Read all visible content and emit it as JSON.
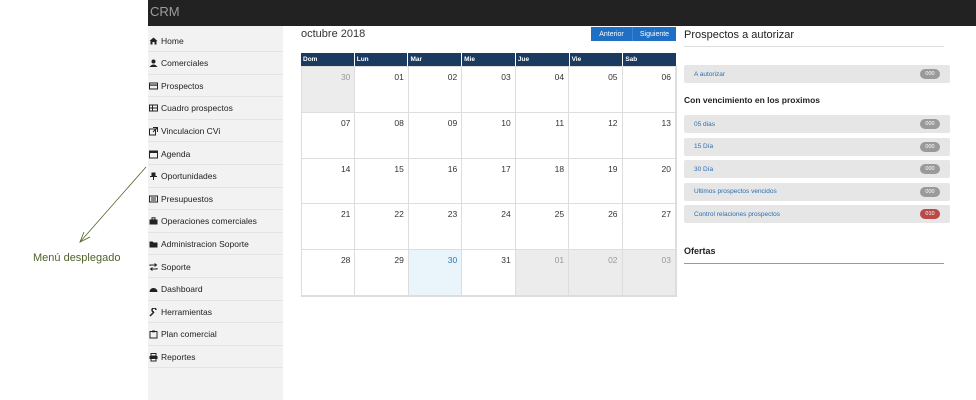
{
  "app": {
    "brand": "CRM"
  },
  "sidebar": {
    "items": [
      {
        "label": "Home",
        "icon": "home-icon"
      },
      {
        "label": "Comerciales",
        "icon": "user-icon"
      },
      {
        "label": "Prospectos",
        "icon": "credit-card-icon"
      },
      {
        "label": "Cuadro prospectos",
        "icon": "table-icon"
      },
      {
        "label": "Vinculacion CVi",
        "icon": "external-link-icon"
      },
      {
        "label": "Agenda",
        "icon": "calendar-icon"
      },
      {
        "label": "Oportunidades",
        "icon": "pin-icon"
      },
      {
        "label": "Presupuestos",
        "icon": "list-icon"
      },
      {
        "label": "Operaciones comerciales",
        "icon": "briefcase-icon"
      },
      {
        "label": "Administracion Soporte",
        "icon": "folder-open-icon"
      },
      {
        "label": "Soporte",
        "icon": "retweet-icon"
      },
      {
        "label": "Dashboard",
        "icon": "dashboard-icon"
      },
      {
        "label": "Herramientas",
        "icon": "wrench-icon"
      },
      {
        "label": "Plan comercial",
        "icon": "clipboard-icon"
      },
      {
        "label": "Reportes",
        "icon": "print-icon"
      }
    ]
  },
  "annotation": {
    "label": "Menú desplegado"
  },
  "calendar": {
    "month_label": "octubre 2018",
    "prev_label": "Anterior",
    "next_label": "Siguiente",
    "weekdays": [
      "Dom",
      "Lun",
      "Mar",
      "Mie",
      "Jue",
      "Vie",
      "Sab"
    ],
    "weeks": [
      [
        {
          "d": "30",
          "s": "other"
        },
        {
          "d": "01"
        },
        {
          "d": "02"
        },
        {
          "d": "03"
        },
        {
          "d": "04"
        },
        {
          "d": "05"
        },
        {
          "d": "06"
        }
      ],
      [
        {
          "d": "07"
        },
        {
          "d": "08"
        },
        {
          "d": "09"
        },
        {
          "d": "10"
        },
        {
          "d": "11"
        },
        {
          "d": "12"
        },
        {
          "d": "13"
        }
      ],
      [
        {
          "d": "14"
        },
        {
          "d": "15"
        },
        {
          "d": "16"
        },
        {
          "d": "17"
        },
        {
          "d": "18"
        },
        {
          "d": "19"
        },
        {
          "d": "20"
        }
      ],
      [
        {
          "d": "21"
        },
        {
          "d": "22"
        },
        {
          "d": "23"
        },
        {
          "d": "24"
        },
        {
          "d": "25"
        },
        {
          "d": "26"
        },
        {
          "d": "27"
        }
      ],
      [
        {
          "d": "28"
        },
        {
          "d": "29"
        },
        {
          "d": "30",
          "s": "today"
        },
        {
          "d": "31"
        },
        {
          "d": "01",
          "s": "other"
        },
        {
          "d": "02",
          "s": "other"
        },
        {
          "d": "03",
          "s": "other"
        }
      ]
    ]
  },
  "right_panel": {
    "title": "Prospectos a autorizar",
    "authorize": {
      "label": "A autorizar",
      "count": "000"
    },
    "subtitle": "Con vencimiento en los proximos",
    "items": [
      {
        "label": "05 dias",
        "count": "000",
        "color": "#9a9a9a"
      },
      {
        "label": "15 Día",
        "count": "000",
        "color": "#9a9a9a"
      },
      {
        "label": "30 Día",
        "count": "000",
        "color": "#9a9a9a"
      },
      {
        "label": "Ultimos prospectos vencidos",
        "count": "000",
        "color": "#9a9a9a"
      },
      {
        "label": "Control relaciones prospectos",
        "count": "010",
        "color": "#b94a48"
      }
    ],
    "ofertas_title": "Ofertas"
  }
}
